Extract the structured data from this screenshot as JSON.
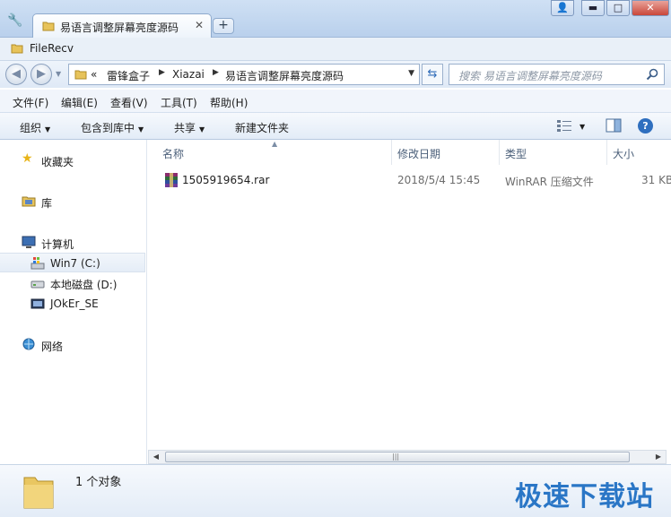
{
  "tab": {
    "title": "易语言调整屏幕亮度源码",
    "close": "✕",
    "new": "+"
  },
  "window_buttons": {
    "user": "👤",
    "minimize": "▬",
    "maximize": "□",
    "close": "✕"
  },
  "path_label": "FileRecv",
  "address": {
    "overflow": "«",
    "crumbs": [
      "雷锋盒子",
      "Xiazai",
      "易语言调整屏幕亮度源码"
    ]
  },
  "search": {
    "placeholder": "搜索 易语言调整屏幕亮度源码"
  },
  "menu": [
    "文件(F)",
    "编辑(E)",
    "查看(V)",
    "工具(T)",
    "帮助(H)"
  ],
  "toolbar": {
    "organize": "组织",
    "include_library": "包含到库中",
    "share": "共享",
    "new_folder": "新建文件夹",
    "help": "?"
  },
  "nav": {
    "favorites": "收藏夹",
    "libraries": "库",
    "computer": "计算机",
    "drive_c": "Win7 (C:)",
    "drive_d": "本地磁盘 (D:)",
    "drive_se": "JOkEr_SE",
    "network": "网络"
  },
  "columns": {
    "name": "名称",
    "date": "修改日期",
    "type": "类型",
    "size": "大小"
  },
  "files": [
    {
      "name": "1505919654.rar",
      "date": "2018/5/4 15:45",
      "type": "WinRAR 压缩文件",
      "size": "31 KB"
    }
  ],
  "status": {
    "count": "1 个对象"
  },
  "watermark": "极速下载站",
  "colors": {
    "accent": "#2a76c6",
    "folder": "#e7c35a"
  }
}
